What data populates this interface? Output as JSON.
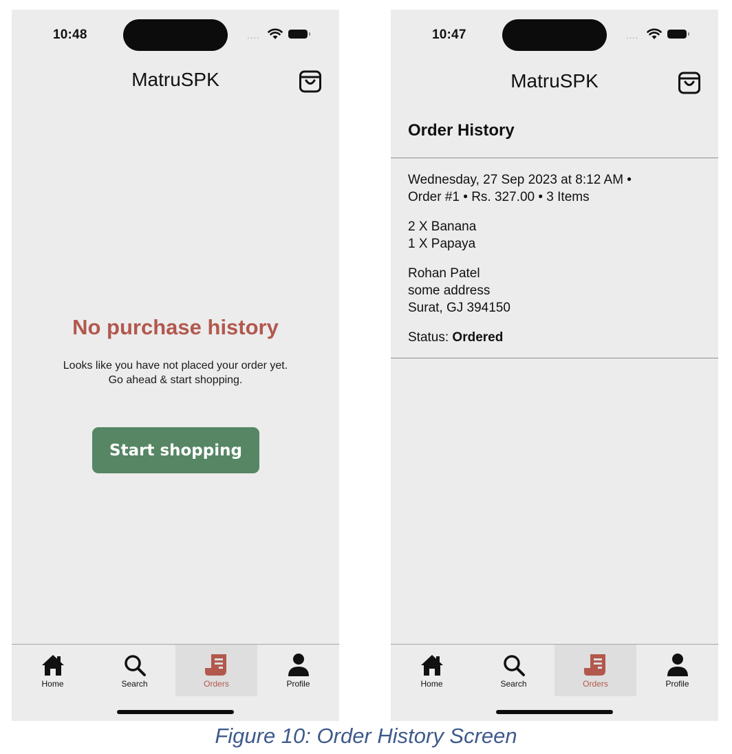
{
  "app": {
    "title": "MatruSPK",
    "accent_color": "#b2584d",
    "button_color": "#568664",
    "background_color": "#ececec"
  },
  "screens": {
    "empty": {
      "time": "10:48",
      "empty_title": "No purchase history",
      "empty_message_line1": "Looks like you have not placed your order yet.",
      "empty_message_line2": "Go ahead & start shopping.",
      "start_button_label": "Start shopping"
    },
    "history": {
      "time": "10:47",
      "section_title": "Order History",
      "order": {
        "meta_line1": "Wednesday, 27 Sep 2023 at 8:12 AM •",
        "meta_line2": "Order #1 • Rs. 327.00 • 3 Items",
        "items": [
          "2 X Banana",
          "1 X Papaya"
        ],
        "address": [
          "Rohan Patel",
          "some address",
          "Surat, GJ 394150"
        ],
        "status_label": "Status: ",
        "status_value": "Ordered"
      }
    }
  },
  "tabs": [
    {
      "label": "Home",
      "icon": "home-icon",
      "active": false
    },
    {
      "label": "Search",
      "icon": "search-icon",
      "active": false
    },
    {
      "label": "Orders",
      "icon": "receipt-icon",
      "active": true
    },
    {
      "label": "Profile",
      "icon": "person-icon",
      "active": false
    }
  ],
  "caption": "Figure 10: Order History Screen"
}
